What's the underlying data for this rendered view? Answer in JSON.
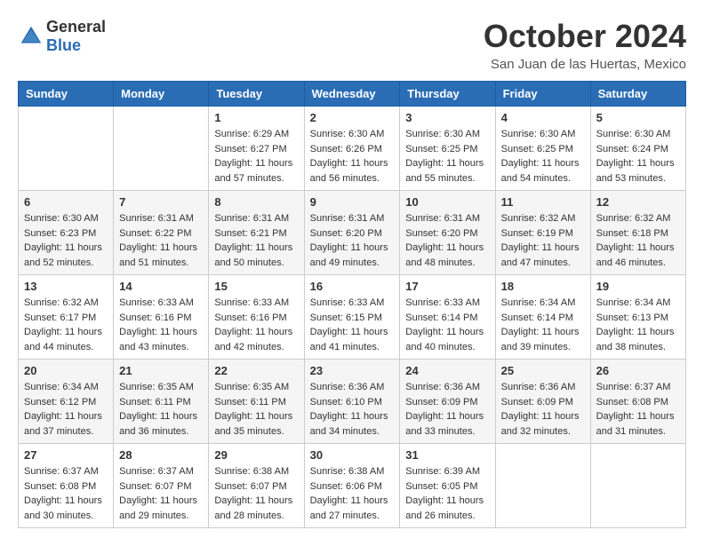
{
  "logo": {
    "general": "General",
    "blue": "Blue"
  },
  "title": "October 2024",
  "location": "San Juan de las Huertas, Mexico",
  "days_of_week": [
    "Sunday",
    "Monday",
    "Tuesday",
    "Wednesday",
    "Thursday",
    "Friday",
    "Saturday"
  ],
  "weeks": [
    [
      {
        "day": "",
        "sunrise": "",
        "sunset": "",
        "daylight": ""
      },
      {
        "day": "",
        "sunrise": "",
        "sunset": "",
        "daylight": ""
      },
      {
        "day": "1",
        "sunrise": "Sunrise: 6:29 AM",
        "sunset": "Sunset: 6:27 PM",
        "daylight": "Daylight: 11 hours and 57 minutes."
      },
      {
        "day": "2",
        "sunrise": "Sunrise: 6:30 AM",
        "sunset": "Sunset: 6:26 PM",
        "daylight": "Daylight: 11 hours and 56 minutes."
      },
      {
        "day": "3",
        "sunrise": "Sunrise: 6:30 AM",
        "sunset": "Sunset: 6:25 PM",
        "daylight": "Daylight: 11 hours and 55 minutes."
      },
      {
        "day": "4",
        "sunrise": "Sunrise: 6:30 AM",
        "sunset": "Sunset: 6:25 PM",
        "daylight": "Daylight: 11 hours and 54 minutes."
      },
      {
        "day": "5",
        "sunrise": "Sunrise: 6:30 AM",
        "sunset": "Sunset: 6:24 PM",
        "daylight": "Daylight: 11 hours and 53 minutes."
      }
    ],
    [
      {
        "day": "6",
        "sunrise": "Sunrise: 6:30 AM",
        "sunset": "Sunset: 6:23 PM",
        "daylight": "Daylight: 11 hours and 52 minutes."
      },
      {
        "day": "7",
        "sunrise": "Sunrise: 6:31 AM",
        "sunset": "Sunset: 6:22 PM",
        "daylight": "Daylight: 11 hours and 51 minutes."
      },
      {
        "day": "8",
        "sunrise": "Sunrise: 6:31 AM",
        "sunset": "Sunset: 6:21 PM",
        "daylight": "Daylight: 11 hours and 50 minutes."
      },
      {
        "day": "9",
        "sunrise": "Sunrise: 6:31 AM",
        "sunset": "Sunset: 6:20 PM",
        "daylight": "Daylight: 11 hours and 49 minutes."
      },
      {
        "day": "10",
        "sunrise": "Sunrise: 6:31 AM",
        "sunset": "Sunset: 6:20 PM",
        "daylight": "Daylight: 11 hours and 48 minutes."
      },
      {
        "day": "11",
        "sunrise": "Sunrise: 6:32 AM",
        "sunset": "Sunset: 6:19 PM",
        "daylight": "Daylight: 11 hours and 47 minutes."
      },
      {
        "day": "12",
        "sunrise": "Sunrise: 6:32 AM",
        "sunset": "Sunset: 6:18 PM",
        "daylight": "Daylight: 11 hours and 46 minutes."
      }
    ],
    [
      {
        "day": "13",
        "sunrise": "Sunrise: 6:32 AM",
        "sunset": "Sunset: 6:17 PM",
        "daylight": "Daylight: 11 hours and 44 minutes."
      },
      {
        "day": "14",
        "sunrise": "Sunrise: 6:33 AM",
        "sunset": "Sunset: 6:16 PM",
        "daylight": "Daylight: 11 hours and 43 minutes."
      },
      {
        "day": "15",
        "sunrise": "Sunrise: 6:33 AM",
        "sunset": "Sunset: 6:16 PM",
        "daylight": "Daylight: 11 hours and 42 minutes."
      },
      {
        "day": "16",
        "sunrise": "Sunrise: 6:33 AM",
        "sunset": "Sunset: 6:15 PM",
        "daylight": "Daylight: 11 hours and 41 minutes."
      },
      {
        "day": "17",
        "sunrise": "Sunrise: 6:33 AM",
        "sunset": "Sunset: 6:14 PM",
        "daylight": "Daylight: 11 hours and 40 minutes."
      },
      {
        "day": "18",
        "sunrise": "Sunrise: 6:34 AM",
        "sunset": "Sunset: 6:14 PM",
        "daylight": "Daylight: 11 hours and 39 minutes."
      },
      {
        "day": "19",
        "sunrise": "Sunrise: 6:34 AM",
        "sunset": "Sunset: 6:13 PM",
        "daylight": "Daylight: 11 hours and 38 minutes."
      }
    ],
    [
      {
        "day": "20",
        "sunrise": "Sunrise: 6:34 AM",
        "sunset": "Sunset: 6:12 PM",
        "daylight": "Daylight: 11 hours and 37 minutes."
      },
      {
        "day": "21",
        "sunrise": "Sunrise: 6:35 AM",
        "sunset": "Sunset: 6:11 PM",
        "daylight": "Daylight: 11 hours and 36 minutes."
      },
      {
        "day": "22",
        "sunrise": "Sunrise: 6:35 AM",
        "sunset": "Sunset: 6:11 PM",
        "daylight": "Daylight: 11 hours and 35 minutes."
      },
      {
        "day": "23",
        "sunrise": "Sunrise: 6:36 AM",
        "sunset": "Sunset: 6:10 PM",
        "daylight": "Daylight: 11 hours and 34 minutes."
      },
      {
        "day": "24",
        "sunrise": "Sunrise: 6:36 AM",
        "sunset": "Sunset: 6:09 PM",
        "daylight": "Daylight: 11 hours and 33 minutes."
      },
      {
        "day": "25",
        "sunrise": "Sunrise: 6:36 AM",
        "sunset": "Sunset: 6:09 PM",
        "daylight": "Daylight: 11 hours and 32 minutes."
      },
      {
        "day": "26",
        "sunrise": "Sunrise: 6:37 AM",
        "sunset": "Sunset: 6:08 PM",
        "daylight": "Daylight: 11 hours and 31 minutes."
      }
    ],
    [
      {
        "day": "27",
        "sunrise": "Sunrise: 6:37 AM",
        "sunset": "Sunset: 6:08 PM",
        "daylight": "Daylight: 11 hours and 30 minutes."
      },
      {
        "day": "28",
        "sunrise": "Sunrise: 6:37 AM",
        "sunset": "Sunset: 6:07 PM",
        "daylight": "Daylight: 11 hours and 29 minutes."
      },
      {
        "day": "29",
        "sunrise": "Sunrise: 6:38 AM",
        "sunset": "Sunset: 6:07 PM",
        "daylight": "Daylight: 11 hours and 28 minutes."
      },
      {
        "day": "30",
        "sunrise": "Sunrise: 6:38 AM",
        "sunset": "Sunset: 6:06 PM",
        "daylight": "Daylight: 11 hours and 27 minutes."
      },
      {
        "day": "31",
        "sunrise": "Sunrise: 6:39 AM",
        "sunset": "Sunset: 6:05 PM",
        "daylight": "Daylight: 11 hours and 26 minutes."
      },
      {
        "day": "",
        "sunrise": "",
        "sunset": "",
        "daylight": ""
      },
      {
        "day": "",
        "sunrise": "",
        "sunset": "",
        "daylight": ""
      }
    ]
  ]
}
